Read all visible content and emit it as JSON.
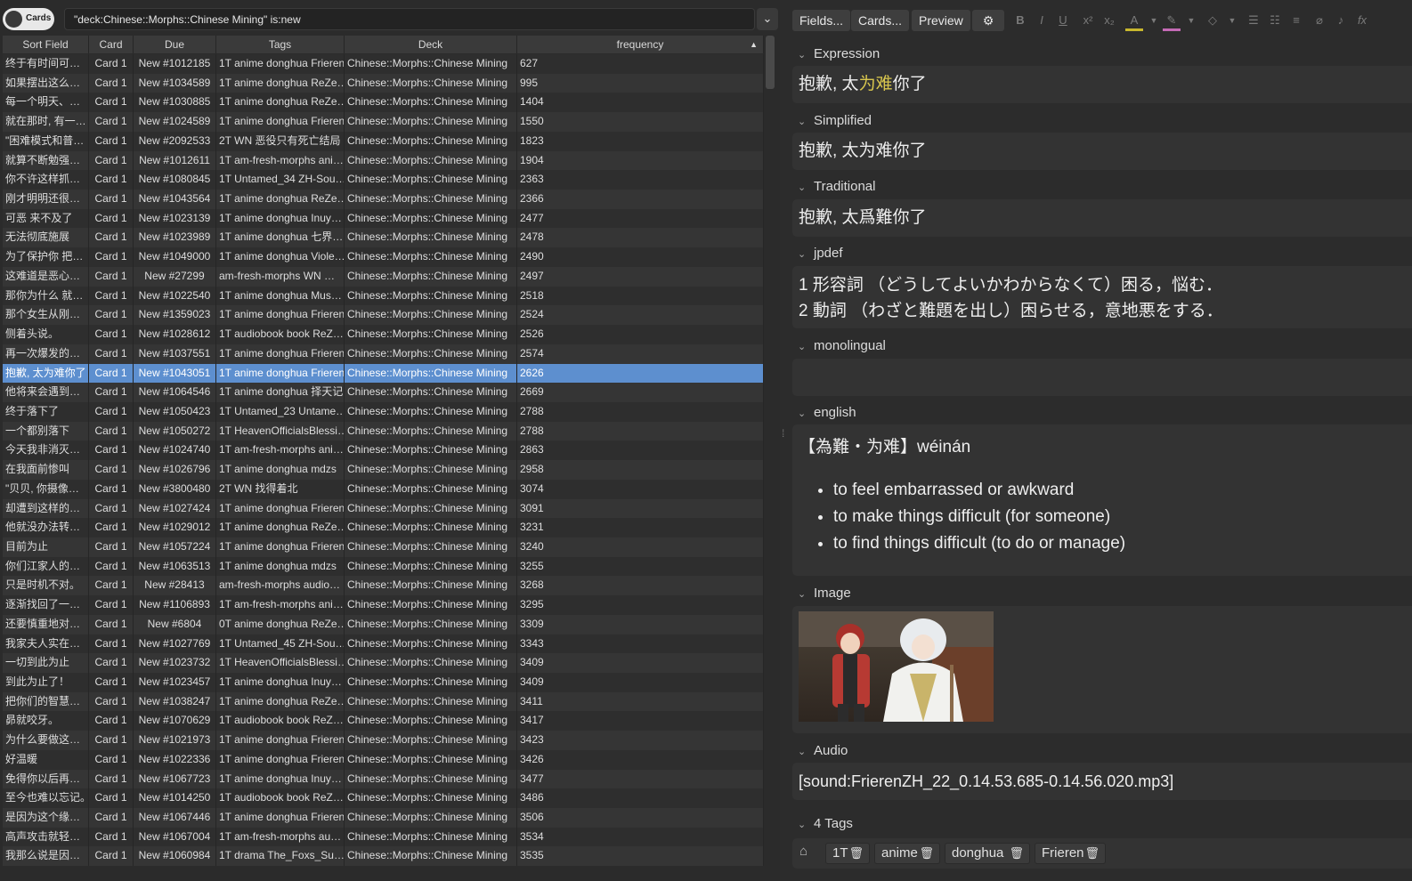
{
  "search": {
    "toggle_label": "Cards",
    "query": "\"deck:Chinese::Morphs::Chinese Mining\" is:new"
  },
  "table": {
    "headers": [
      "Sort Field",
      "Card",
      "Due",
      "Tags",
      "Deck",
      "frequency"
    ],
    "rows": [
      [
        "终于有时间可…",
        "Card 1",
        "New #1012185",
        "1T anime donghua Frieren",
        "Chinese::Morphs::Chinese Mining",
        "627"
      ],
      [
        "如果摆出这么…",
        "Card 1",
        "New #1034589",
        "1T anime donghua ReZe…",
        "Chinese::Morphs::Chinese Mining",
        "995"
      ],
      [
        "每一个明天、…",
        "Card 1",
        "New #1030885",
        "1T anime donghua ReZe…",
        "Chinese::Morphs::Chinese Mining",
        "1404"
      ],
      [
        "就在那时, 有一…",
        "Card 1",
        "New #1024589",
        "1T anime donghua Frieren",
        "Chinese::Morphs::Chinese Mining",
        "1550"
      ],
      [
        "\"困难模式和普…",
        "Card 1",
        "New #2092533",
        "2T WN 恶役只有死亡结局",
        "Chinese::Morphs::Chinese Mining",
        "1823"
      ],
      [
        "就算不断勉强…",
        "Card 1",
        "New #1012611",
        "1T am-fresh-morphs ani…",
        "Chinese::Morphs::Chinese Mining",
        "1904"
      ],
      [
        "你不许这样抓…",
        "Card 1",
        "New #1080845",
        "1T Untamed_34 ZH-Sou…",
        "Chinese::Morphs::Chinese Mining",
        "2363"
      ],
      [
        "刚才明明还很…",
        "Card 1",
        "New #1043564",
        "1T anime donghua ReZe…",
        "Chinese::Morphs::Chinese Mining",
        "2366"
      ],
      [
        "可恶 来不及了",
        "Card 1",
        "New #1023139",
        "1T anime donghua Inuy…",
        "Chinese::Morphs::Chinese Mining",
        "2477"
      ],
      [
        "无法彻底施展",
        "Card 1",
        "New #1023989",
        "1T anime donghua 七界…",
        "Chinese::Morphs::Chinese Mining",
        "2478"
      ],
      [
        "为了保护你 把…",
        "Card 1",
        "New #1049000",
        "1T anime donghua Viole…",
        "Chinese::Morphs::Chinese Mining",
        "2490"
      ],
      [
        "这难道是恶心…",
        "Card 1",
        "New #27299",
        "am-fresh-morphs WN …",
        "Chinese::Morphs::Chinese Mining",
        "2497"
      ],
      [
        "那你为什么 就…",
        "Card 1",
        "New #1022540",
        "1T anime donghua Mus…",
        "Chinese::Morphs::Chinese Mining",
        "2518"
      ],
      [
        "那个女生从刚…",
        "Card 1",
        "New #1359023",
        "1T anime donghua Frieren",
        "Chinese::Morphs::Chinese Mining",
        "2524"
      ],
      [
        "侧着头说。",
        "Card 1",
        "New #1028612",
        "1T audiobook book ReZ…",
        "Chinese::Morphs::Chinese Mining",
        "2526"
      ],
      [
        "再一次爆发的…",
        "Card 1",
        "New #1037551",
        "1T anime donghua Frieren",
        "Chinese::Morphs::Chinese Mining",
        "2574"
      ],
      [
        "抱歉, 太为难你了",
        "Card 1",
        "New #1043051",
        "1T anime donghua Frieren",
        "Chinese::Morphs::Chinese Mining",
        "2626"
      ],
      [
        "他将来会遇到…",
        "Card 1",
        "New #1064546",
        "1T anime donghua 择天记",
        "Chinese::Morphs::Chinese Mining",
        "2669"
      ],
      [
        "终于落下了",
        "Card 1",
        "New #1050423",
        "1T Untamed_23 Untame…",
        "Chinese::Morphs::Chinese Mining",
        "2788"
      ],
      [
        "一个都别落下",
        "Card 1",
        "New #1050272",
        "1T HeavenOfficialsBlessi…",
        "Chinese::Morphs::Chinese Mining",
        "2788"
      ],
      [
        "今天我非消灭…",
        "Card 1",
        "New #1024740",
        "1T am-fresh-morphs ani…",
        "Chinese::Morphs::Chinese Mining",
        "2863"
      ],
      [
        "在我面前惨叫",
        "Card 1",
        "New #1026796",
        "1T anime donghua mdzs",
        "Chinese::Morphs::Chinese Mining",
        "2958"
      ],
      [
        "\"贝贝, 你摄像…",
        "Card 1",
        "New #3800480",
        "2T WN 找得着北",
        "Chinese::Morphs::Chinese Mining",
        "3074"
      ],
      [
        "却遭到这样的…",
        "Card 1",
        "New #1027424",
        "1T anime donghua Frieren",
        "Chinese::Morphs::Chinese Mining",
        "3091"
      ],
      [
        "他就没办法转…",
        "Card 1",
        "New #1029012",
        "1T anime donghua ReZe…",
        "Chinese::Morphs::Chinese Mining",
        "3231"
      ],
      [
        "目前为止",
        "Card 1",
        "New #1057224",
        "1T anime donghua Frieren",
        "Chinese::Morphs::Chinese Mining",
        "3240"
      ],
      [
        "你们江家人的…",
        "Card 1",
        "New #1063513",
        "1T anime donghua mdzs",
        "Chinese::Morphs::Chinese Mining",
        "3255"
      ],
      [
        "只是时机不对。",
        "Card 1",
        "New #28413",
        "am-fresh-morphs audio…",
        "Chinese::Morphs::Chinese Mining",
        "3268"
      ],
      [
        "逐渐找回了一…",
        "Card 1",
        "New #1106893",
        "1T am-fresh-morphs ani…",
        "Chinese::Morphs::Chinese Mining",
        "3295"
      ],
      [
        "还要慎重地对…",
        "Card 1",
        "New #6804",
        "0T anime donghua ReZe…",
        "Chinese::Morphs::Chinese Mining",
        "3309"
      ],
      [
        "我家夫人实在…",
        "Card 1",
        "New #1027769",
        "1T Untamed_45 ZH-Sou…",
        "Chinese::Morphs::Chinese Mining",
        "3343"
      ],
      [
        "一切到此为止",
        "Card 1",
        "New #1023732",
        "1T HeavenOfficialsBlessi…",
        "Chinese::Morphs::Chinese Mining",
        "3409"
      ],
      [
        "到此为止了！",
        "Card 1",
        "New #1023457",
        "1T anime donghua Inuy…",
        "Chinese::Morphs::Chinese Mining",
        "3409"
      ],
      [
        "把你们的智慧…",
        "Card 1",
        "New #1038247",
        "1T anime donghua ReZe…",
        "Chinese::Morphs::Chinese Mining",
        "3411"
      ],
      [
        "昴就咬牙。",
        "Card 1",
        "New #1070629",
        "1T audiobook book ReZ…",
        "Chinese::Morphs::Chinese Mining",
        "3417"
      ],
      [
        "为什么要做这…",
        "Card 1",
        "New #1021973",
        "1T anime donghua Frieren",
        "Chinese::Morphs::Chinese Mining",
        "3423"
      ],
      [
        "好温暖",
        "Card 1",
        "New #1022336",
        "1T anime donghua Frieren",
        "Chinese::Morphs::Chinese Mining",
        "3426"
      ],
      [
        "免得你以后再…",
        "Card 1",
        "New #1067723",
        "1T anime donghua Inuy…",
        "Chinese::Morphs::Chinese Mining",
        "3477"
      ],
      [
        "至今也难以忘记。",
        "Card 1",
        "New #1014250",
        "1T audiobook book ReZ…",
        "Chinese::Morphs::Chinese Mining",
        "3486"
      ],
      [
        "是因为这个缘…",
        "Card 1",
        "New #1067446",
        "1T anime donghua Frieren",
        "Chinese::Morphs::Chinese Mining",
        "3506"
      ],
      [
        "高声攻击就轻…",
        "Card 1",
        "New #1067004",
        "1T am-fresh-morphs au…",
        "Chinese::Morphs::Chinese Mining",
        "3534"
      ],
      [
        "我那么说是因…",
        "Card 1",
        "New #1060984",
        "1T drama The_Foxs_Su…",
        "Chinese::Morphs::Chinese Mining",
        "3535"
      ]
    ]
  },
  "toolbar": {
    "fields": "Fields...",
    "cards": "Cards...",
    "preview": "Preview"
  },
  "editor": {
    "expression_label": "Expression",
    "expression_pre": "抱歉, 太",
    "expression_hl": "为难",
    "expression_post": "你了",
    "simplified_label": "Simplified",
    "simplified": "抱歉, 太为难你了",
    "traditional_label": "Traditional",
    "traditional": "抱歉, 太爲難你了",
    "jpdef_label": "jpdef",
    "jpdef_1": "1 形容詞 （どうしてよいかわからなくて）困る，悩む．",
    "jpdef_2": "2 動詞 （わざと難題を出し）困らせる，意地悪をする．",
    "monolingual_label": "monolingual",
    "english_label": "english",
    "english_head": "【為難・为难】wéinán",
    "english_items": [
      "to feel embarrassed or awkward",
      "to make things difficult (for someone)",
      "to find things difficult (to do or manage)"
    ],
    "image_label": "Image",
    "audio_label": "Audio",
    "audio": "[sound:FrierenZH_22_0.14.53.685-0.14.56.020.mp3]",
    "tags_label": "4 Tags",
    "tags": [
      "1T",
      "anime",
      "donghua",
      "Frieren"
    ]
  },
  "selected_row_index": 16,
  "colors": {
    "selection": "#5d8fcf",
    "highlight": "#d9c74e"
  }
}
